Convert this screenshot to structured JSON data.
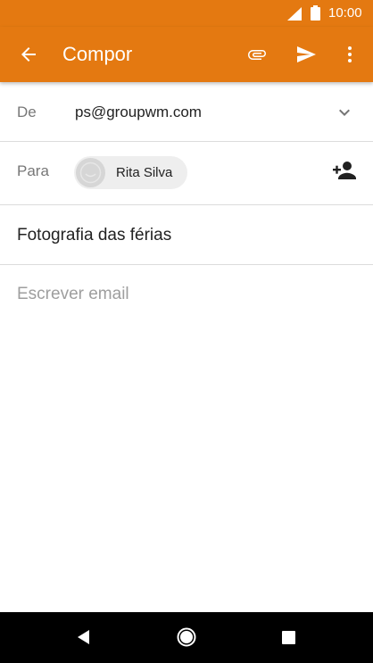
{
  "status_bar": {
    "time": "10:00",
    "icons": [
      "signal-icon",
      "battery-icon"
    ]
  },
  "app_bar": {
    "title": "Compor",
    "background_color": "#e47911",
    "icons": [
      "back-arrow-icon",
      "paperclip-icon",
      "send-icon",
      "more-vert-icon"
    ]
  },
  "compose": {
    "from": {
      "label": "De",
      "value": "ps@groupwm.com",
      "icon": "chevron-down-icon"
    },
    "to": {
      "label": "Para",
      "recipient_name": "Rita Silva",
      "add_icon": "add-contact-icon"
    },
    "subject": {
      "value": "Fotografia das férias"
    },
    "body": {
      "placeholder": "Escrever email"
    }
  },
  "nav_bar": {
    "icons": [
      "nav-back-icon",
      "nav-home-icon",
      "nav-recent-icon"
    ]
  }
}
